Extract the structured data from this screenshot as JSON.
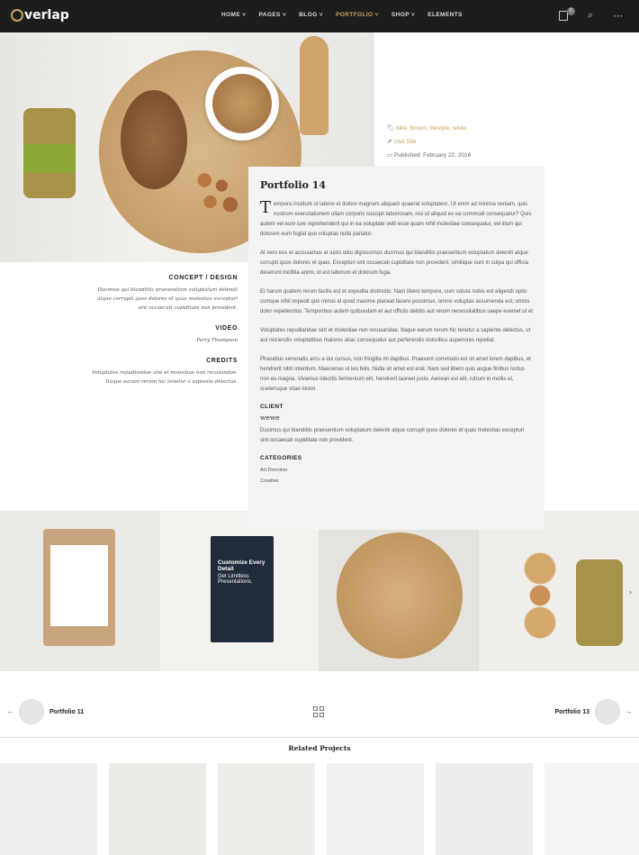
{
  "brand": {
    "name": "verlap",
    "accent": "#c9a45c"
  },
  "nav": {
    "items": [
      "HOME ˅",
      "PAGES ˅",
      "BLOG ˅",
      "PORTFOLIO ˅",
      "SHOP ˅",
      "ELEMENTS"
    ],
    "active": "PORTFOLIO",
    "cart_count": "0"
  },
  "meta": {
    "tags": [
      "bike,",
      "Brown,",
      "lifestyle,",
      "white"
    ],
    "visit": "Visit Site",
    "published": "Published: February 22, 2016"
  },
  "card": {
    "title": "Portfolio 14",
    "drop": "T",
    "p1": "empora incidunt ut labore et dolore magnam aliquam quaerat voluptatem. Ut enim ad minima veniam, quis nostrum exercitationem ullam corporis suscipit laboriosam, nisi ut aliquid ex ea commodi consequatur? Quis autem vel eum iure reprehenderit qui in ea voluptate velit esse quam nihil molestiae consequatur, vel illum qui dolorem eum fugiat quo voluptas nulla pariatur.",
    "p2": "At vero eos et accusamus et iusto odio dignissimos ducimus qui blanditiis praesentium voluptatum deleniti atque corrupti quos dolores et quas. Excepturi sint occaecati cupiditate non provident, similique sunt in culpa qui officia deserunt mollitia animi, id est laborum et dolorum fuga.",
    "p3": "Et harum quidem rerum facilis est et expedita distinctio. Nam libero tempore, cum soluta nobis est eligendi optio cumque nihil impedit quo minus id quod maxime placeat facere possimus, omnis voluptas assumenda est, omnis dolor repellendus. Temporibus autem quibusdam et aut officiis debitis aut rerum necessitatibus saepe eveniet ut et",
    "p4": "Voluptates repudiandae sint et molestiae non recusandae. Itaque earum rerum hic tenetur a sapiente delectus, ut aut reiciendis voluptatibus maiores alias consequatur aut perferendis doloribus asperiores repellat.",
    "p5": "Phasellus venenatis arcu a dui cursus, non fringilla mi dapibus. Praesent commodo est sit amet lorem dapibus, et hendrerit nibh interdum. Maecenas ut leo felis. Nulla sit amet est erat. Nam sed libero quis augue finibus luctus non eu magna. Vivamus lobortis fermentum elit, hendrerit laoreet justo. Aenean est elit, rutrum in mollis et, scelerisque vitae lorem.",
    "client_h": "CLIENT",
    "client": "wewe",
    "client_p": "Ducimus qui blanditiis praesentium voluptatum deleniti atque corrupti quos dolores et quas molestias excepturi sint occaecati cupiditate non provident.",
    "cat_h": "CATEGORIES",
    "cats": [
      "Art Direction",
      "Creative"
    ]
  },
  "side": {
    "concept_h": "CONCEPT / DESIGN",
    "concept": "Ducimus qui blanditiis praesentium voluptatum deleniti atque corrupti quos dolores et quas molestias excepturi sint occaecati cupiditate non provident.",
    "video_h": "VIDEO",
    "video": "Perry Thompson",
    "credits_h": "CREDITS",
    "credits": "Voluptates repudiandae sint et molestiae non recusandae. Itaque earum rerum hic tenetur a sapiente delectus."
  },
  "gallery": {
    "pouch_title": "Customize Every Detail",
    "pouch_sub": "Get Limitless Presentations."
  },
  "pager": {
    "prev": "Portfolio 11",
    "next": "Portfolio 13"
  },
  "related": {
    "title": "Related Projects"
  }
}
